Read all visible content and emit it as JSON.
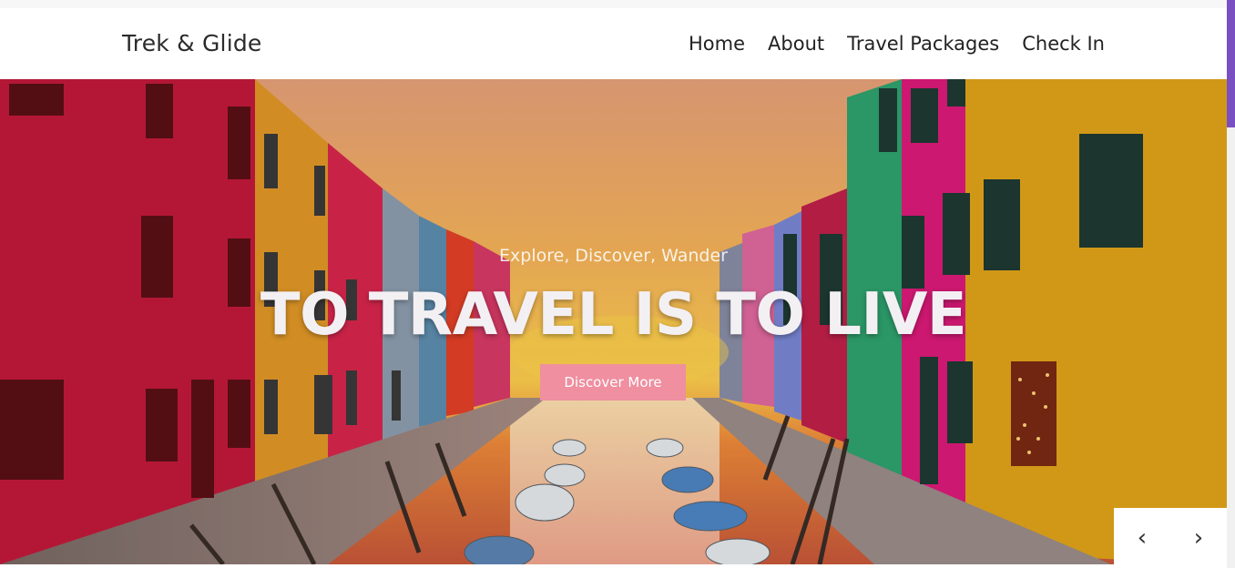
{
  "header": {
    "brand": "Trek & Glide",
    "nav": [
      "Home",
      "About",
      "Travel Packages",
      "Check In"
    ]
  },
  "hero": {
    "subtitle": "Explore, Discover, Wander",
    "title": "TO TRAVEL IS TO LIVE",
    "cta_label": "Discover More"
  },
  "slider": {
    "prev_icon": "chevron-left-icon",
    "next_icon": "chevron-right-icon",
    "prev_glyph": "‹",
    "next_glyph": "›"
  },
  "colors": {
    "accent_button": "#ef8fa0",
    "scroll_thumb": "#7a4fc2",
    "sky_top": "#f6a860",
    "sky_glow": "#ffd966"
  }
}
